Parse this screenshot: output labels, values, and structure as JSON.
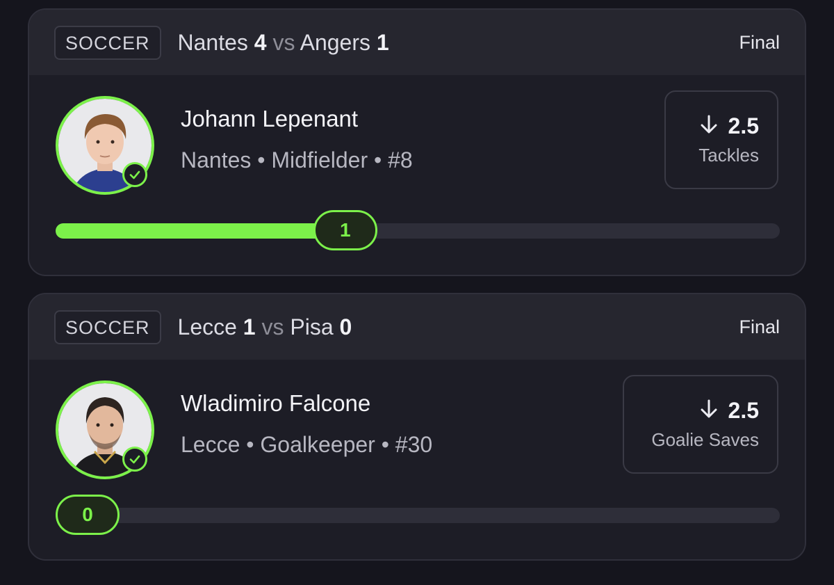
{
  "props": [
    {
      "sport": "SOCCER",
      "home_team": "Nantes",
      "home_score": "4",
      "vs": "vs",
      "away_team": "Angers",
      "away_score": "1",
      "status": "Final",
      "player_name": "Johann Lepenant",
      "team": "Nantes",
      "position": "Midfielder",
      "number": "#8",
      "direction_icon": "arrow-down-icon",
      "line": "2.5",
      "stat": "Tackles",
      "actual": "1",
      "progress_fraction": 0.4,
      "checked": true
    },
    {
      "sport": "SOCCER",
      "home_team": "Lecce",
      "home_score": "1",
      "vs": "vs",
      "away_team": "Pisa",
      "away_score": "0",
      "status": "Final",
      "player_name": "Wladimiro Falcone",
      "team": "Lecce",
      "position": "Goalkeeper",
      "number": "#30",
      "direction_icon": "arrow-down-icon",
      "line": "2.5",
      "stat": "Goalie Saves",
      "actual": "0",
      "progress_fraction": 0.0,
      "checked": true
    }
  ],
  "colors": {
    "accent": "#7cf14a",
    "background": "#15151d",
    "card": "#1d1d26"
  }
}
